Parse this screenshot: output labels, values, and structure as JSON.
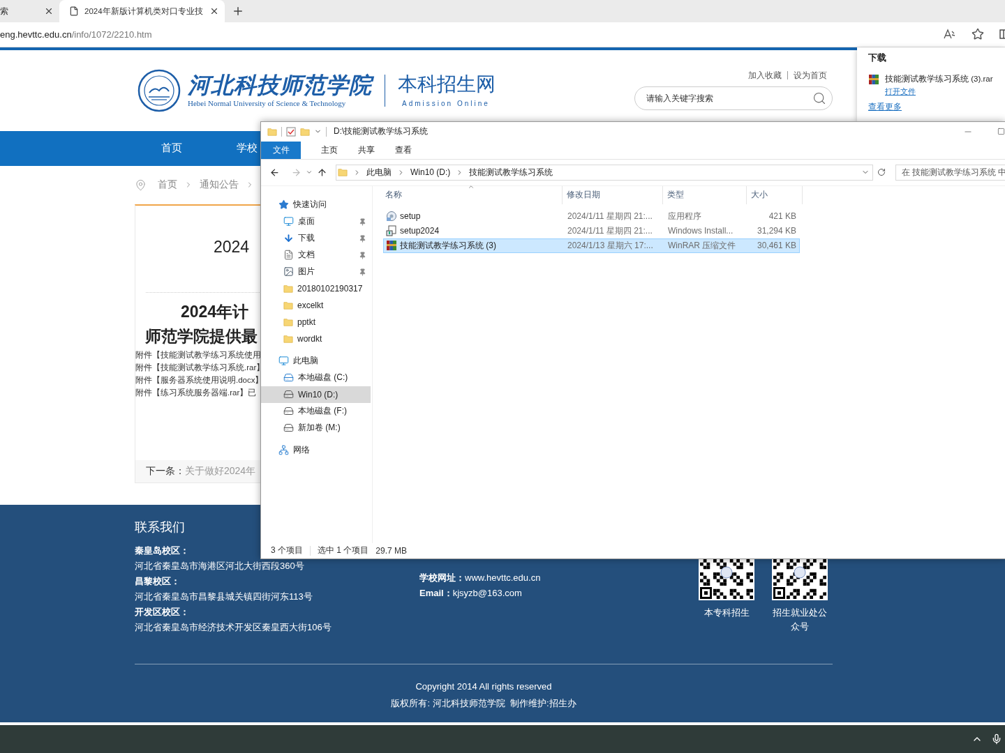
{
  "browser": {
    "tabs": [
      {
        "label": "索",
        "selected": false
      },
      {
        "label": "2024年新版计算机类对口专业技",
        "selected": true
      }
    ],
    "address": {
      "host": "eng.hevttc.edu.cn",
      "path": "/info/1072/2210.htm"
    }
  },
  "downloads": {
    "title": "下载",
    "items": [
      {
        "name": "技能测试教学练习系统 (3).rar",
        "action": "打开文件"
      }
    ],
    "more": "查看更多"
  },
  "site": {
    "top_links": [
      "加入收藏",
      "设为首页"
    ],
    "logo": {
      "name_cn": "河北科技师范学院",
      "name_en": "Hebei Normal University of Science & Technology",
      "site": "本科招生网",
      "site_en": "Admission Online"
    },
    "search": {
      "placeholder": "请输入关键字搜索"
    },
    "nav": [
      "首页",
      "学校"
    ],
    "breadcrumb": [
      "首页",
      "通知公告"
    ],
    "article": {
      "title": "2024",
      "heading": [
        "2024年计",
        "师范学院提供最"
      ],
      "attachments": [
        "附件【技能测试教学练习系统使用",
        "附件【技能测试教学练习系统.rar】",
        "附件【服务器系统使用说明.docx】",
        "附件【练习系统服务器端.rar】已"
      ],
      "next": {
        "label": "下一条：",
        "title": "关于做好2024年"
      }
    },
    "footer": {
      "title": "联系我们",
      "campuses": [
        {
          "name": "秦皇岛校区：",
          "address": "河北省秦皇岛市海港区河北大街西段360号"
        },
        {
          "name": "昌黎校区：",
          "address": "河北省秦皇岛市昌黎县城关镇四街河东113号"
        },
        {
          "name": "开发区校区：",
          "address": "河北省秦皇岛市经济技术开发区秦皇西大街106号"
        }
      ],
      "contacts": [
        {
          "label": "学校网址：",
          "value": "www.hevttc.edu.cn"
        },
        {
          "label": "Email：",
          "value": "kjsyzb@163.com"
        }
      ],
      "qr_codes": [
        {
          "caption": "本专科招生"
        },
        {
          "caption": "招生就业处公众号"
        }
      ],
      "copyright": "Copyright 2014 All rights reserved",
      "owner": "版权所有: 河北科技师范学院  制作维护:招生办"
    }
  },
  "explorer": {
    "path": "D:\\技能测试教学练习系统",
    "ribbon_tabs": [
      {
        "label": "文件",
        "selected": true
      },
      {
        "label": "主页",
        "selected": false
      },
      {
        "label": "共享",
        "selected": false
      },
      {
        "label": "查看",
        "selected": false
      }
    ],
    "breadcrumb": [
      "此电脑",
      "Win10 (D:)",
      "技能测试教学练习系统"
    ],
    "search": {
      "placeholder": "在 技能测试教学练习系统 中"
    },
    "nav_tree": [
      {
        "label": "快速访问",
        "kind": "star",
        "selected": false,
        "children": [
          {
            "label": "桌面",
            "kind": "desktop",
            "pinned": true,
            "selected": false
          },
          {
            "label": "下载",
            "kind": "download",
            "pinned": true,
            "selected": false
          },
          {
            "label": "文档",
            "kind": "document",
            "pinned": true,
            "selected": false
          },
          {
            "label": "图片",
            "kind": "picture",
            "pinned": true,
            "selected": false
          },
          {
            "label": "20180102190317",
            "kind": "folder",
            "pinned": false,
            "selected": false
          },
          {
            "label": "excelkt",
            "kind": "folder",
            "pinned": false,
            "selected": false
          },
          {
            "label": "pptkt",
            "kind": "folder",
            "pinned": false,
            "selected": false
          },
          {
            "label": "wordkt",
            "kind": "folder",
            "pinned": false,
            "selected": false
          }
        ]
      },
      {
        "label": "此电脑",
        "kind": "pc",
        "selected": false,
        "children": [
          {
            "label": "本地磁盘 (C:)",
            "kind": "system-drive",
            "pinned": false,
            "selected": false
          },
          {
            "label": "Win10 (D:)",
            "kind": "drive",
            "pinned": false,
            "selected": true
          },
          {
            "label": "本地磁盘 (F:)",
            "kind": "drive",
            "pinned": false,
            "selected": false
          },
          {
            "label": "新加卷 (M:)",
            "kind": "drive",
            "pinned": false,
            "selected": false
          }
        ]
      },
      {
        "label": "网络",
        "kind": "network",
        "selected": false
      }
    ],
    "columns": [
      "名称",
      "修改日期",
      "类型",
      "大小"
    ],
    "files": [
      {
        "name": "setup",
        "kind": "app",
        "modified": "2024/1/11 星期四 21:...",
        "type": "应用程序",
        "size": "421 KB",
        "selected": false
      },
      {
        "name": "setup2024",
        "kind": "installer",
        "modified": "2024/1/11 星期四 21:...",
        "type": "Windows Install...",
        "size": "31,294 KB",
        "selected": false
      },
      {
        "name": "技能测试教学练习系统 (3)",
        "kind": "archive",
        "modified": "2024/1/13 星期六 17:...",
        "type": "WinRAR 压缩文件",
        "size": "30,461 KB",
        "selected": true
      }
    ],
    "status": {
      "count": "3 个项目",
      "selection": "选中 1 个项目",
      "size": "29.7 MB"
    }
  }
}
